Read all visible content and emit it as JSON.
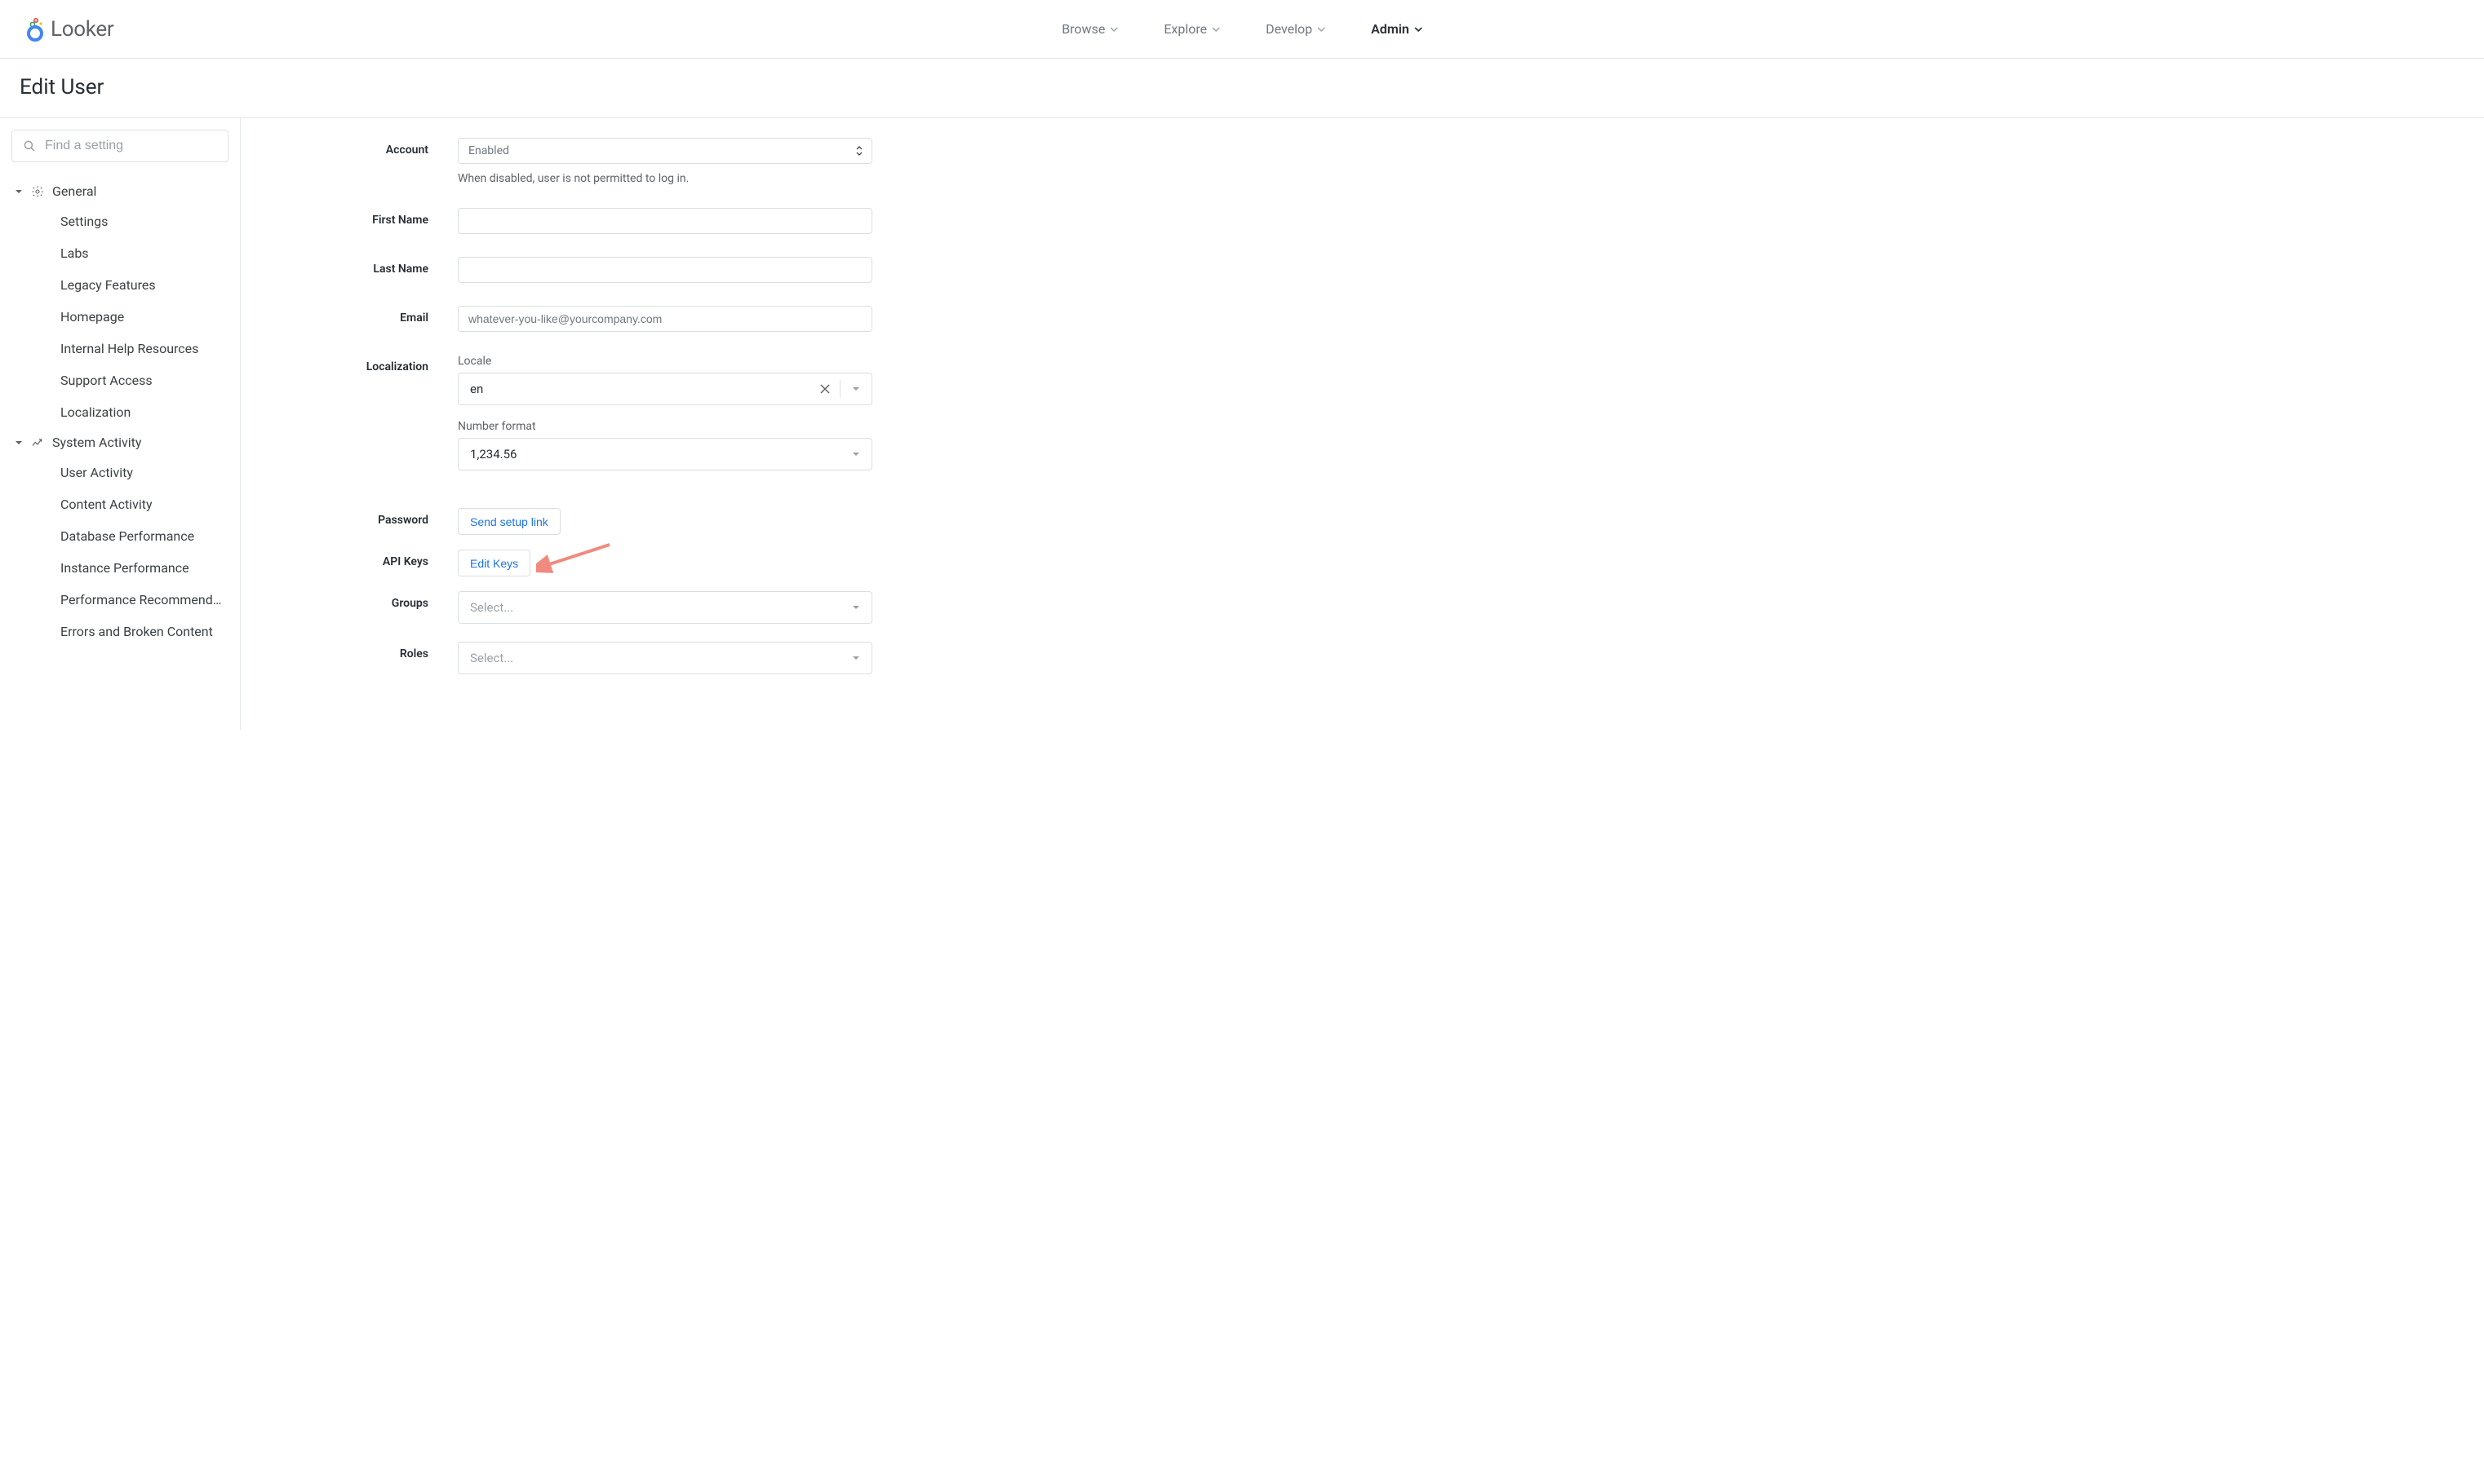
{
  "header": {
    "logo": "Looker",
    "nav": [
      {
        "label": "Browse",
        "active": false
      },
      {
        "label": "Explore",
        "active": false
      },
      {
        "label": "Develop",
        "active": false
      },
      {
        "label": "Admin",
        "active": true
      }
    ]
  },
  "page": {
    "title": "Edit User"
  },
  "sidebar": {
    "search_placeholder": "Find a setting",
    "groups": [
      {
        "label": "General",
        "items": [
          "Settings",
          "Labs",
          "Legacy Features",
          "Homepage",
          "Internal Help Resources",
          "Support Access",
          "Localization"
        ]
      },
      {
        "label": "System Activity",
        "items": [
          "User Activity",
          "Content Activity",
          "Database Performance",
          "Instance Performance",
          "Performance Recommendati…",
          "Errors and Broken Content"
        ]
      }
    ]
  },
  "form": {
    "account": {
      "label": "Account",
      "value": "Enabled",
      "hint": "When disabled, user is not permitted to log in."
    },
    "first_name": {
      "label": "First Name",
      "value": ""
    },
    "last_name": {
      "label": "Last Name",
      "value": ""
    },
    "email": {
      "label": "Email",
      "value": "whatever-you-like@yourcompany.com"
    },
    "localization": {
      "label": "Localization",
      "locale_label": "Locale",
      "locale_value": "en",
      "number_format_label": "Number format",
      "number_format_value": "1,234.56"
    },
    "password": {
      "label": "Password",
      "button": "Send setup link"
    },
    "api_keys": {
      "label": "API Keys",
      "button": "Edit Keys"
    },
    "groups": {
      "label": "Groups",
      "placeholder": "Select..."
    },
    "roles": {
      "label": "Roles",
      "placeholder": "Select..."
    }
  }
}
